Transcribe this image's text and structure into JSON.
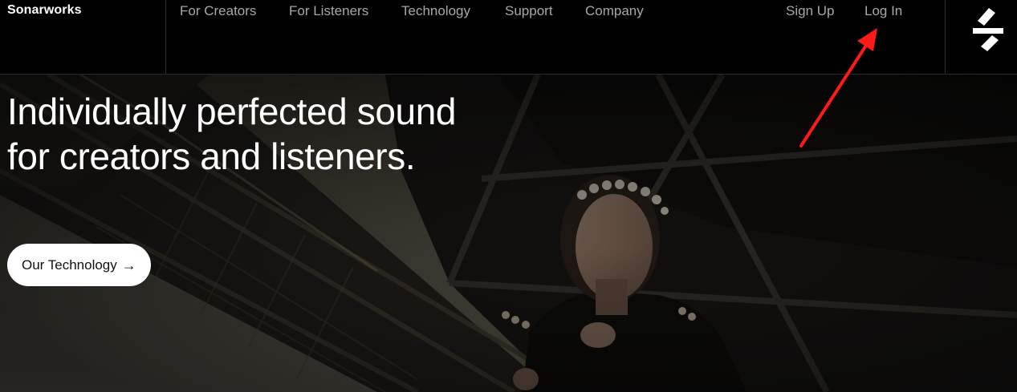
{
  "brand": {
    "name": "Sonarworks"
  },
  "nav": {
    "items": [
      {
        "label": "For Creators"
      },
      {
        "label": "For Listeners"
      },
      {
        "label": "Technology"
      },
      {
        "label": "Support"
      },
      {
        "label": "Company"
      }
    ],
    "account": {
      "sign_up": "Sign Up",
      "log_in": "Log In"
    },
    "logo_icon": "sonarworks-logo-icon"
  },
  "hero": {
    "title": "Individually perfected sound for creators and listeners.",
    "cta_label": "Our Technology",
    "cta_icon": "arrow-right-icon",
    "background_image": "singer-under-steel-bridge-photo"
  },
  "annotation": {
    "icon": "red-arrow-pointer",
    "target": "log-in-link",
    "color": "#ff1a1a"
  },
  "colors": {
    "header_bg": "#000000",
    "nav_text": "#a8a8a8",
    "text_primary": "#ffffff",
    "button_bg": "#ffffff",
    "button_text": "#111111"
  }
}
